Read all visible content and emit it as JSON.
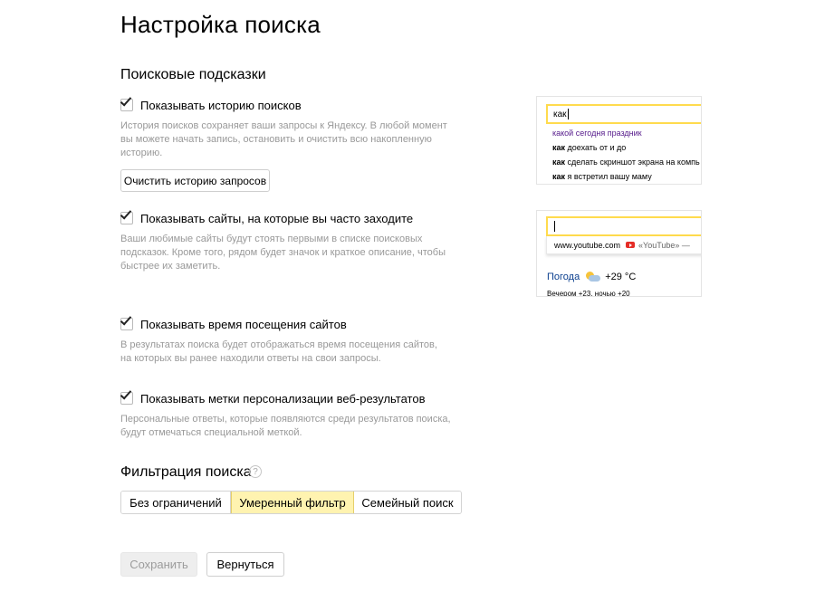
{
  "page": {
    "title": "Настройка поиска"
  },
  "suggestions_section": {
    "title": "Поисковые подсказки"
  },
  "options": [
    {
      "label": "Показывать историю поисков",
      "checked": true,
      "description": "История поисков сохраняет ваши запросы к Яндексу. В любой момент вы можете начать запись, остановить и очистить всю накопленную историю."
    },
    {
      "label": "Показывать сайты, на которые вы часто заходите",
      "checked": true,
      "description": "Ваши любимые сайты будут стоять первыми в списке поисковых подсказок. Кроме того, рядом будет значок и краткое описание, чтобы быстрее их заметить."
    },
    {
      "label": "Показывать время посещения сайтов",
      "checked": true,
      "description": "В результатах поиска будет отображаться время посещения сайтов, на которых вы ранее находили ответы на свои запросы."
    },
    {
      "label": "Показывать метки персонализации веб-результатов",
      "checked": true,
      "description": "Персональные ответы, которые появляются среди результатов поиска, будут отмечаться специальной меткой."
    }
  ],
  "clear_history_button": "Очистить историю запросов",
  "preview_history": {
    "query": "как",
    "suggestions": [
      {
        "bold": "",
        "rest": "какой сегодня праздник"
      },
      {
        "bold": "как",
        "rest": " доехать от и до"
      },
      {
        "bold": "как",
        "rest": " сделать скриншот экрана на компь"
      },
      {
        "bold": "как",
        "rest": " я встретил вашу маму"
      }
    ]
  },
  "preview_sites": {
    "site_url": "www.youtube.com",
    "site_title": "«YouTube» —",
    "weather_label": "Погода",
    "weather_temp": "+29 °C",
    "weather_sub": "Вечером +23,  ночью +20"
  },
  "filter_section": {
    "title": "Фильтрация поиска",
    "help_icon": "?",
    "options": [
      "Без ограничений",
      "Умеренный фильтр",
      "Семейный поиск"
    ],
    "selected": "Умеренный фильтр"
  },
  "footer": {
    "save_label": "Сохранить",
    "back_label": "Вернуться"
  },
  "colors": {
    "accent_yellow": "#ffdb4d",
    "selected_segment": "#fff3b0",
    "muted_text": "#999999",
    "visited_link": "#551a8b"
  }
}
